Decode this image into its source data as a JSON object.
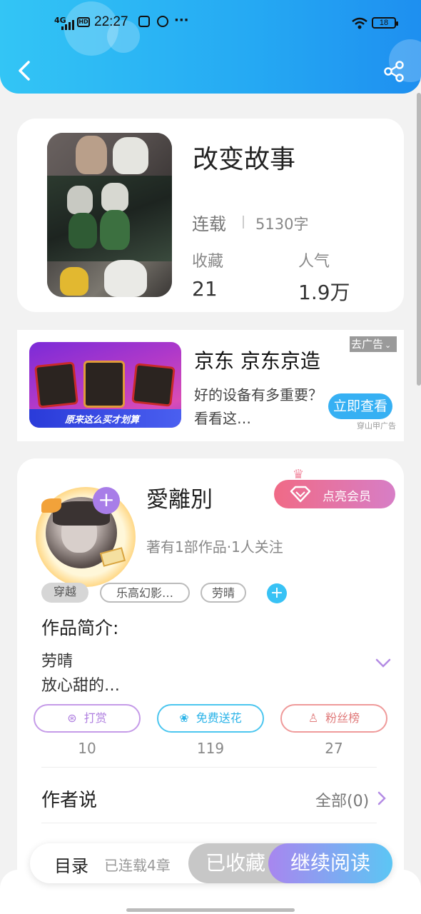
{
  "status_bar": {
    "network": "4G",
    "hd": "HD",
    "time": "22:27",
    "battery": "18"
  },
  "book": {
    "title": "改变故事",
    "status": "连载",
    "word_count": "5130字",
    "favorites_label": "收藏",
    "favorites_value": "21",
    "popularity_label": "人气",
    "popularity_value": "1.9万"
  },
  "ad": {
    "title": "京东 京东京造",
    "description": "好的设备有多重要？看看这…",
    "close_label": "去广告",
    "cta_label": "立即查看",
    "source": "穿山甲广告",
    "banner_text": "原来这么买才划算"
  },
  "author": {
    "name": "愛離別",
    "vip_label": "点亮会员",
    "info": "著有1部作品·1人关注",
    "tags": [
      "穿越",
      "乐高幻影…",
      "劳晴"
    ]
  },
  "intro": {
    "heading": "作品简介:",
    "line1": "劳晴",
    "line2": "放心甜的…"
  },
  "actions": {
    "reward_label": "打赏",
    "reward_count": "10",
    "flower_label": "免费送花",
    "flower_count": "119",
    "fans_label": "粉丝榜",
    "fans_count": "27"
  },
  "author_says": {
    "heading": "作者说",
    "all_label": "全部(0)"
  },
  "bottom_bar": {
    "toc_label": "目录",
    "chapters_label": "已连载4章",
    "collected_label": "已收藏",
    "continue_label": "继续阅读"
  },
  "colors": {
    "header_accent": "#25a9f3",
    "vip": "#f06a86",
    "continue": "#a886ef"
  }
}
